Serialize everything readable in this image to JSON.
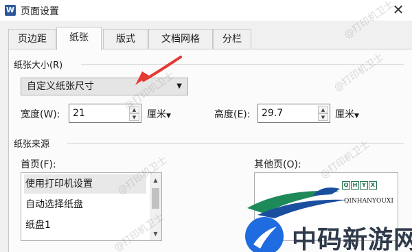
{
  "window": {
    "app_icon": "W",
    "title": "页面设置",
    "close": "✕"
  },
  "tabs": [
    {
      "label": "页边距",
      "active": false
    },
    {
      "label": "纸张",
      "active": true
    },
    {
      "label": "版式",
      "active": false
    },
    {
      "label": "文档网格",
      "active": false
    },
    {
      "label": "分栏",
      "active": false
    }
  ],
  "paper_size": {
    "group_label": "纸张大小(R)",
    "selected": "自定义纸张尺寸",
    "width_label": "宽度(W):",
    "width_value": "21",
    "width_unit": "厘米",
    "height_label": "高度(E):",
    "height_value": "29.7",
    "height_unit": "厘米"
  },
  "paper_source": {
    "group_label": "纸张来源",
    "first_page_label": "首页(F):",
    "first_page_items": [
      "使用打印机设置",
      "自动选择纸盘",
      "纸盘1"
    ],
    "other_pages_label": "其他页(O):"
  },
  "watermark": {
    "text": "@打印机卫士"
  },
  "brand": {
    "mini_letters": [
      "Q",
      "H",
      "Y",
      "X"
    ],
    "subtitle": "QINHANYOUXI",
    "name": "中码新游网",
    "colors": {
      "circle": "#1f6be0",
      "wing_green": "#1e8a5a",
      "wing_blue": "#1a4fa0"
    }
  },
  "annotation": {
    "arrow_color": "#e53935"
  }
}
